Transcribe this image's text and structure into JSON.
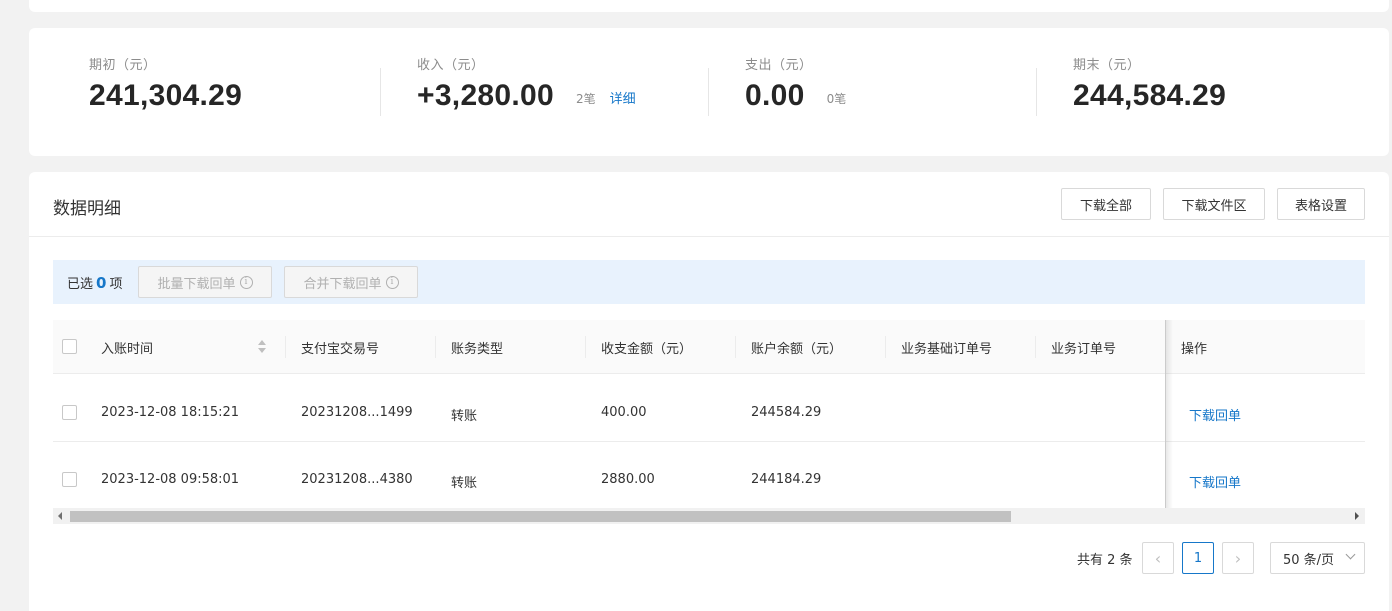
{
  "summary": {
    "opening": {
      "label": "期初（元）",
      "value": "241,304.29"
    },
    "income": {
      "label": "收入（元）",
      "value": "+3,280.00",
      "count": "2笔",
      "detail_link": "详细"
    },
    "expense": {
      "label": "支出（元）",
      "value": "0.00",
      "count": "0笔"
    },
    "closing": {
      "label": "期末（元）",
      "value": "244,584.29"
    }
  },
  "detail": {
    "title": "数据明细",
    "buttons": {
      "download_all": "下载全部",
      "download_area": "下载文件区",
      "table_settings": "表格设置"
    }
  },
  "selection": {
    "prefix": "已选",
    "count": "0",
    "suffix": "项",
    "batch_download": "批量下载回单",
    "merge_download": "合并下载回单"
  },
  "table": {
    "columns": [
      "入账时间",
      "支付宝交易号",
      "账务类型",
      "收支金额（元）",
      "账户余额（元）",
      "业务基础订单号",
      "业务订单号",
      "操作"
    ],
    "rows": [
      {
        "time": "2023-12-08 18:15:21",
        "trade_no": "20231208...1499",
        "type": "转账",
        "amount": "400.00",
        "balance": "244584.29",
        "base_order": "",
        "order": "",
        "action": "下载回单"
      },
      {
        "time": "2023-12-08 09:58:01",
        "trade_no": "20231208...4380",
        "type": "转账",
        "amount": "2880.00",
        "balance": "244184.29",
        "base_order": "",
        "order": "",
        "action": "下载回单"
      }
    ]
  },
  "pagination": {
    "total": "共有 2 条",
    "current_page": "1",
    "prev": "‹",
    "next": "›",
    "page_size": "50 条/页"
  },
  "colors": {
    "accent": "#1677c9",
    "background": "#f2f2f2",
    "selection_bar": "#e8f2fd"
  }
}
